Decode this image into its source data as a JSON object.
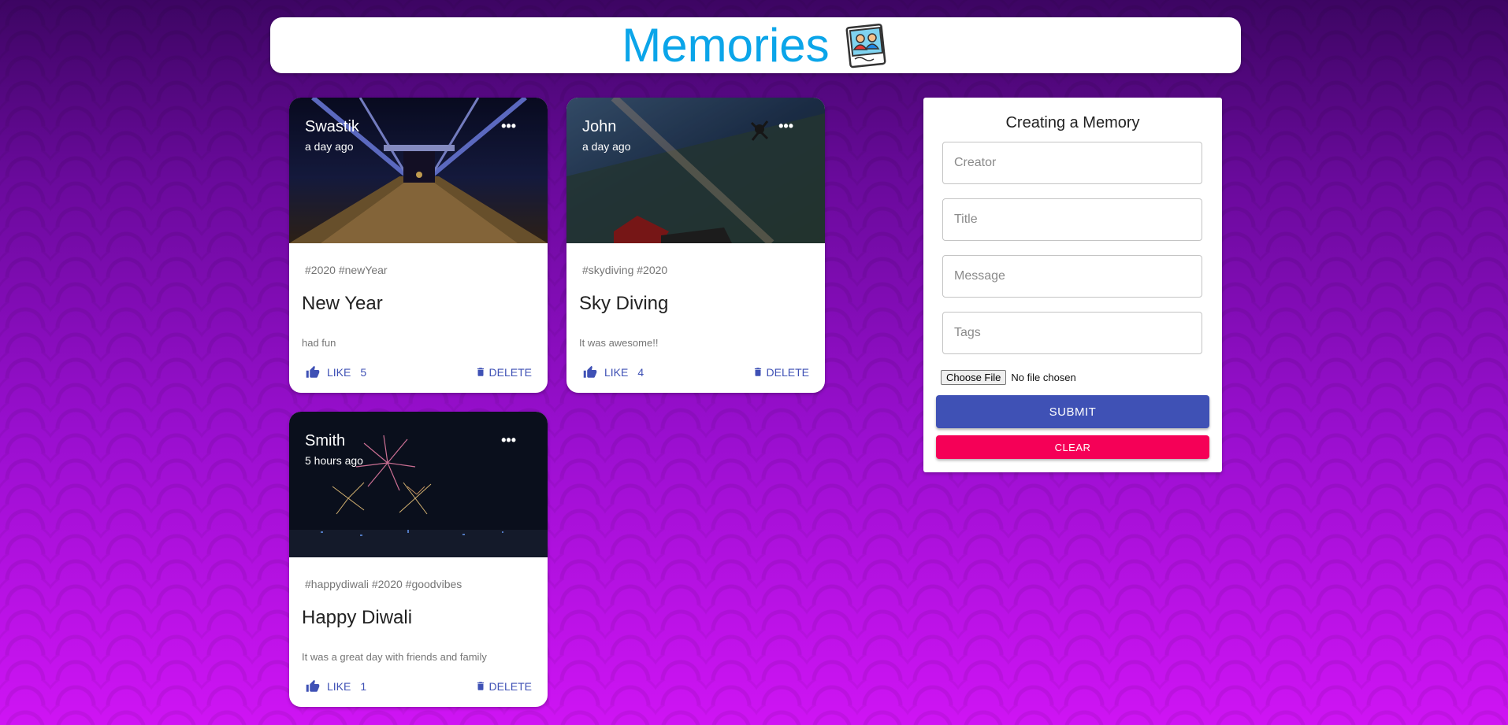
{
  "header": {
    "title": "Memories",
    "logo_icon": "photo-album-icon"
  },
  "posts": [
    {
      "creator": "Swastik",
      "time": "a day ago",
      "tags": "#2020 #newYear",
      "title": "New Year",
      "message": "had fun",
      "like_label": "LIKE",
      "like_count": "5",
      "delete_label": "DELETE",
      "more_icon": "more-horizontal-icon"
    },
    {
      "creator": "John",
      "time": "a day ago",
      "tags": "#skydiving #2020",
      "title": "Sky Diving",
      "message": "It was awesome!!",
      "like_label": "LIKE",
      "like_count": "4",
      "delete_label": "DELETE",
      "more_icon": "more-horizontal-icon"
    },
    {
      "creator": "Smith",
      "time": "5 hours ago",
      "tags": "#happydiwali #2020 #goodvibes",
      "title": "Happy Diwali",
      "message": "It was a great day with friends and family",
      "like_label": "LIKE",
      "like_count": "1",
      "delete_label": "DELETE",
      "more_icon": "more-horizontal-icon"
    }
  ],
  "form": {
    "title": "Creating a Memory",
    "creator_placeholder": "Creator",
    "title_placeholder": "Title",
    "message_placeholder": "Message",
    "tags_placeholder": "Tags",
    "choose_file_label": "Choose File",
    "no_file_text": "No file chosen",
    "submit_label": "SUBMIT",
    "clear_label": "CLEAR"
  },
  "colors": {
    "title_blue": "#0ba5e9",
    "primary": "#3f51b5",
    "secondary": "#f50057",
    "bg_top": "#3d0563",
    "bg_bottom": "#cf14f4"
  }
}
